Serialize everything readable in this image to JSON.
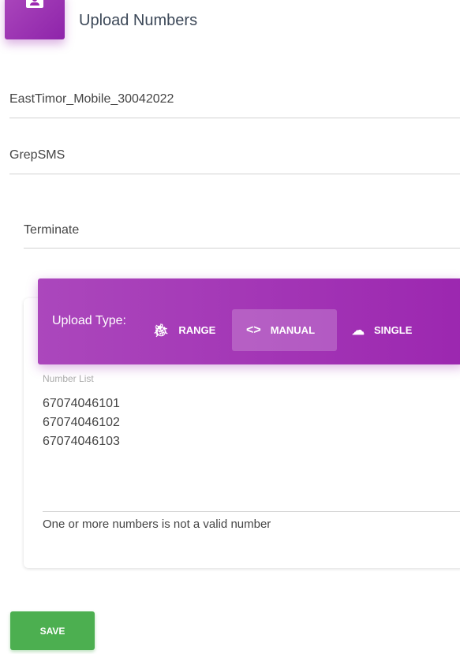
{
  "header": {
    "title": "Upload Numbers",
    "icon": "contact-card-icon"
  },
  "fields": {
    "name": "EastTimor_Mobile_30042022",
    "provider": "GrepSMS",
    "action": "Terminate"
  },
  "upload": {
    "label": "Upload Type:",
    "tabs": [
      {
        "label": "RANGE",
        "icon": "bug-icon",
        "active": false
      },
      {
        "label": "MANUAL",
        "icon": "code-icon",
        "active": true
      },
      {
        "label": "SINGLE",
        "icon": "cloud-icon",
        "active": false
      }
    ],
    "number_list_label": "Number List",
    "numbers": "67074046101\n67074046102\n67074046103",
    "error": "One or more numbers is not a valid number"
  },
  "save_label": "SAVE",
  "colors": {
    "accent": "#9c27b0",
    "save": "#4caf50"
  }
}
